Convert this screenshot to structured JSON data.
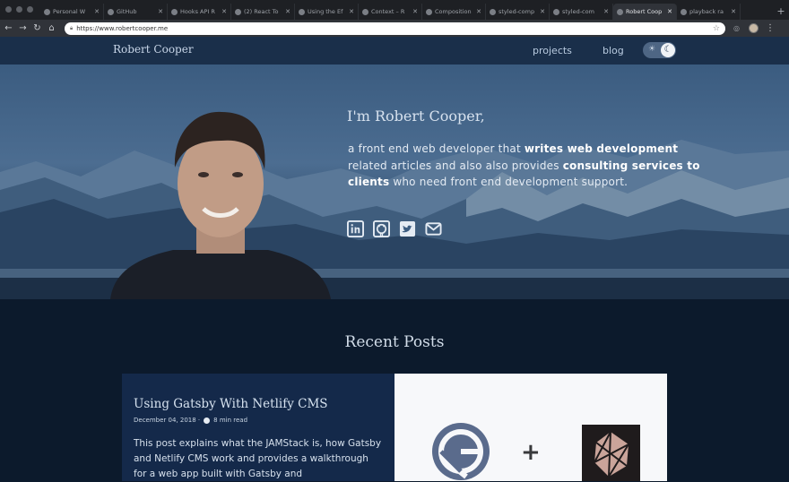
{
  "browser": {
    "tabs": [
      {
        "title": "Personal W"
      },
      {
        "title": "GitHub"
      },
      {
        "title": "Hooks API R"
      },
      {
        "title": "(2) React To"
      },
      {
        "title": "Using the Ef"
      },
      {
        "title": "Context – R"
      },
      {
        "title": "Composition"
      },
      {
        "title": "styled-comp"
      },
      {
        "title": "styled-com"
      },
      {
        "title": "Robert Coop",
        "active": true
      },
      {
        "title": "playback ra"
      }
    ],
    "url": "https://www.robertcooper.me"
  },
  "site": {
    "brand": "Robert Cooper",
    "nav": {
      "projects": "projects",
      "blog": "blog"
    }
  },
  "hero": {
    "greeting": "I'm Robert Cooper,",
    "text_1": "a front end web developer that ",
    "text_2": "writes web development",
    "text_3": " related articles and also also provides ",
    "text_4": "consulting services to clients",
    "text_5": " who need front end development support.",
    "socials": [
      "linkedin-icon",
      "github-icon",
      "twitter-icon",
      "email-icon"
    ]
  },
  "recent_posts": {
    "title": "Recent Posts",
    "post": {
      "title": "Using Gatsby With Netlify CMS",
      "date": "December 04, 2018 ·",
      "read_time": "8 min read",
      "excerpt": "This post explains what the JAMStack is, how Gatsby and Netlify CMS work and provides a walkthrough for a web app built with Gatsby and"
    }
  },
  "colors": {
    "nav_bg": "#1a2f4a",
    "page_bg": "#0c1a2c",
    "card_bg": "#14294a",
    "gatsby_purple": "#5a6b8c"
  }
}
